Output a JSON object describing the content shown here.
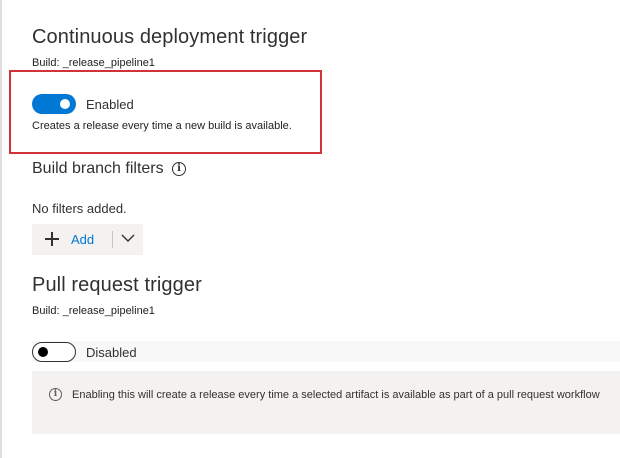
{
  "cd_trigger": {
    "title": "Continuous deployment trigger",
    "build": "Build: _release_pipeline1",
    "toggle_state": "Enabled",
    "description": "Creates a release every time a new build is available.",
    "highlight_color": "#d13438"
  },
  "branch_filters": {
    "heading": "Build branch filters",
    "info_icon": "info-icon",
    "empty_text": "No filters added.",
    "add_label": "Add",
    "add_icon": "plus-icon",
    "dropdown_icon": "chevron-down-icon"
  },
  "pr_trigger": {
    "title": "Pull request trigger",
    "build": "Build: _release_pipeline1",
    "toggle_state": "Disabled",
    "info_text": "Enabling this will create a release every time a selected artifact is available as part of a pull request workflow"
  },
  "colors": {
    "accent": "#0078d4",
    "toggle_on": "#0078d4",
    "panel_bg": "#f3f2f1"
  }
}
